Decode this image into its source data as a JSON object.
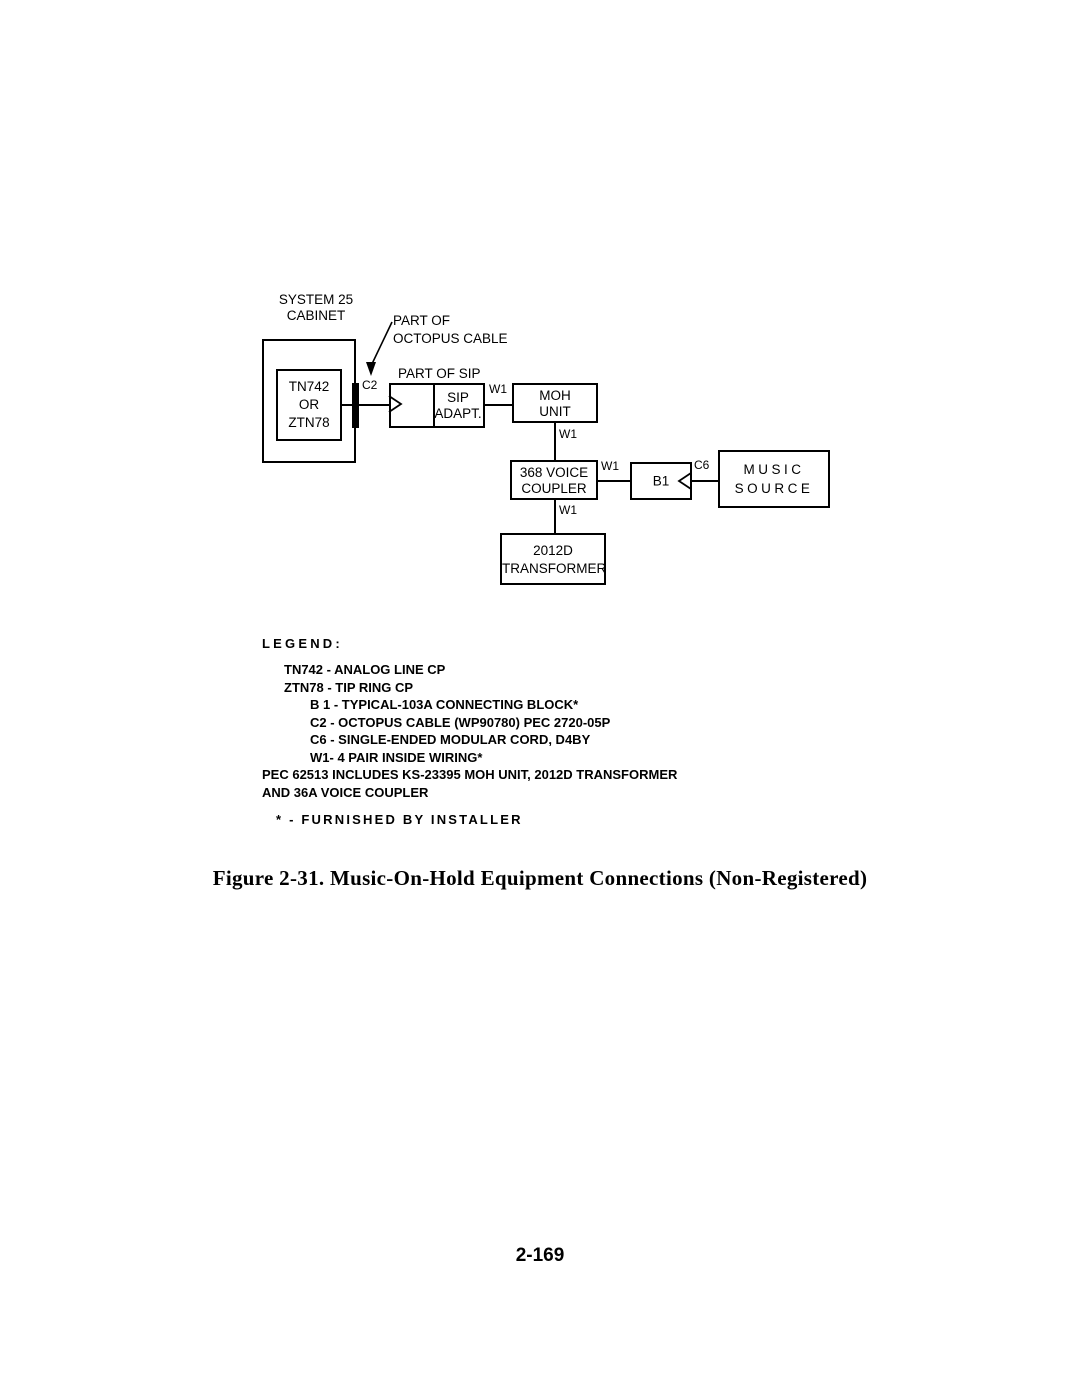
{
  "diagram": {
    "cabinet_title_line1": "SYSTEM 25",
    "cabinet_title_line2": "CABINET",
    "octopus_note_line1": "PART OF",
    "octopus_note_line2": "OCTOPUS CABLE",
    "sip_note": "PART OF SIP",
    "card_line1": "TN742",
    "card_line2": "OR",
    "card_line3": "ZTN78",
    "connector_c2": "C2",
    "sip_adapt_line1": "SIP",
    "sip_adapt_line2": "ADAPT.",
    "moh_unit_line1": "MOH",
    "moh_unit_line2": "UNIT",
    "voice_coupler_line1": "368 VOICE",
    "voice_coupler_line2": "COUPLER",
    "transformer_line1": "2012D",
    "transformer_line2": "TRANSFORMER",
    "block_b1": "B1",
    "connector_c6": "C6",
    "music_source_line1": "MUSIC",
    "music_source_line2": "SOURCE",
    "w1_sip_to_moh": "W1",
    "w1_moh_to_coupler": "W1",
    "w1_coupler_to_transformer": "W1",
    "w1_coupler_to_b1": "W1"
  },
  "legend": {
    "title": "LEGEND:",
    "rows": [
      {
        "text": "TN742 - ANALOG LINE CP",
        "indent": "ind1"
      },
      {
        "text": "ZTN78 - TIP  RING  CP",
        "indent": "ind1"
      },
      {
        "text": "B 1 -  TYPICAL-103A  CONNECTING  BLOCK*",
        "indent": "ind2"
      },
      {
        "text": "C2 -  OCTOPUS  CABLE  (WP90780)  PEC  2720-05P",
        "indent": "ind2"
      },
      {
        "text": "C6 - SINGLE-ENDED MODULAR CORD, D4BY",
        "indent": "ind2"
      },
      {
        "text": "W1- 4 PAIR  INSIDE  WIRING*",
        "indent": "ind2"
      },
      {
        "text": "PEC  62513  INCLUDES  KS-23395  MOH  UNIT,  2012D  TRANSFORMER",
        "indent": "ind0"
      },
      {
        "text": "AND  36A  VOICE  COUPLER",
        "indent": "ind0"
      }
    ],
    "footnote": "*  -  FURNISHED  BY  INSTALLER"
  },
  "caption": "Figure  2-31.  Music-On-Hold  Equipment  Connections  (Non-Registered)",
  "page_number": "2-169"
}
